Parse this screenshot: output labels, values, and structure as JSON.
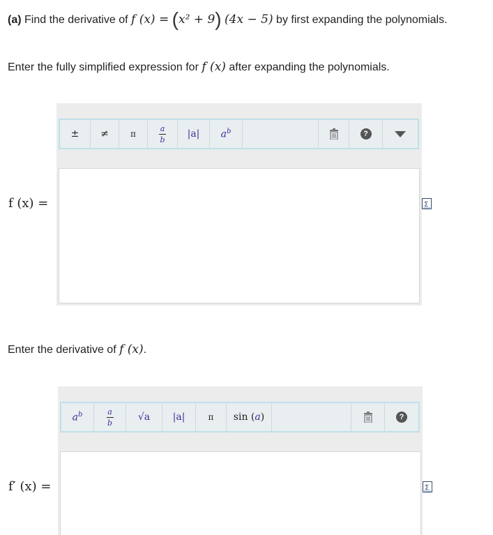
{
  "question": {
    "part": "(a)",
    "text_before": "Find the derivative of",
    "function_lhs": "f (x) =",
    "factor1": "x² + 9",
    "factor2": "(4x − 5)",
    "text_after": "by first expanding the polynomials."
  },
  "step1": {
    "instruction_before": "Enter the fully simplified expression for",
    "instruction_fn": "f (x)",
    "instruction_after": "after expanding the polynomials.",
    "label": "f (x) =",
    "toolbar": {
      "buttons": [
        {
          "name": "plus-minus",
          "glyph": "±"
        },
        {
          "name": "not-equal",
          "glyph": "≠"
        },
        {
          "name": "pi",
          "glyph": "π"
        },
        {
          "name": "fraction",
          "glyph_top": "a",
          "glyph_bottom": "b"
        },
        {
          "name": "absolute-value",
          "glyph": "|a|"
        },
        {
          "name": "exponent",
          "base": "a",
          "exp": "b"
        }
      ],
      "right_icons": [
        "trash-icon",
        "help-icon",
        "dropdown-arrow-icon"
      ]
    },
    "answer_value": ""
  },
  "step2": {
    "instruction_before": "Enter the derivative of",
    "instruction_fn": "f (x)",
    "instruction_after": ".",
    "label": "f′ (x) =",
    "toolbar": {
      "buttons": [
        {
          "name": "exponent",
          "base": "a",
          "exp": "b"
        },
        {
          "name": "fraction",
          "glyph_top": "a",
          "glyph_bottom": "b"
        },
        {
          "name": "square-root",
          "glyph": "√a"
        },
        {
          "name": "absolute-value",
          "glyph": "|a|"
        },
        {
          "name": "pi",
          "glyph": "π"
        },
        {
          "name": "sine",
          "glyph_fn": "sin",
          "glyph_arg": "a"
        }
      ],
      "right_icons": [
        "trash-icon",
        "help-icon"
      ]
    },
    "answer_value": ""
  },
  "colors": {
    "panel_bg": "#ececec",
    "toolbar_bg": "#e9eef0",
    "toolbar_border": "#bfe0ea",
    "variable_purple": "#3a2f9a"
  }
}
